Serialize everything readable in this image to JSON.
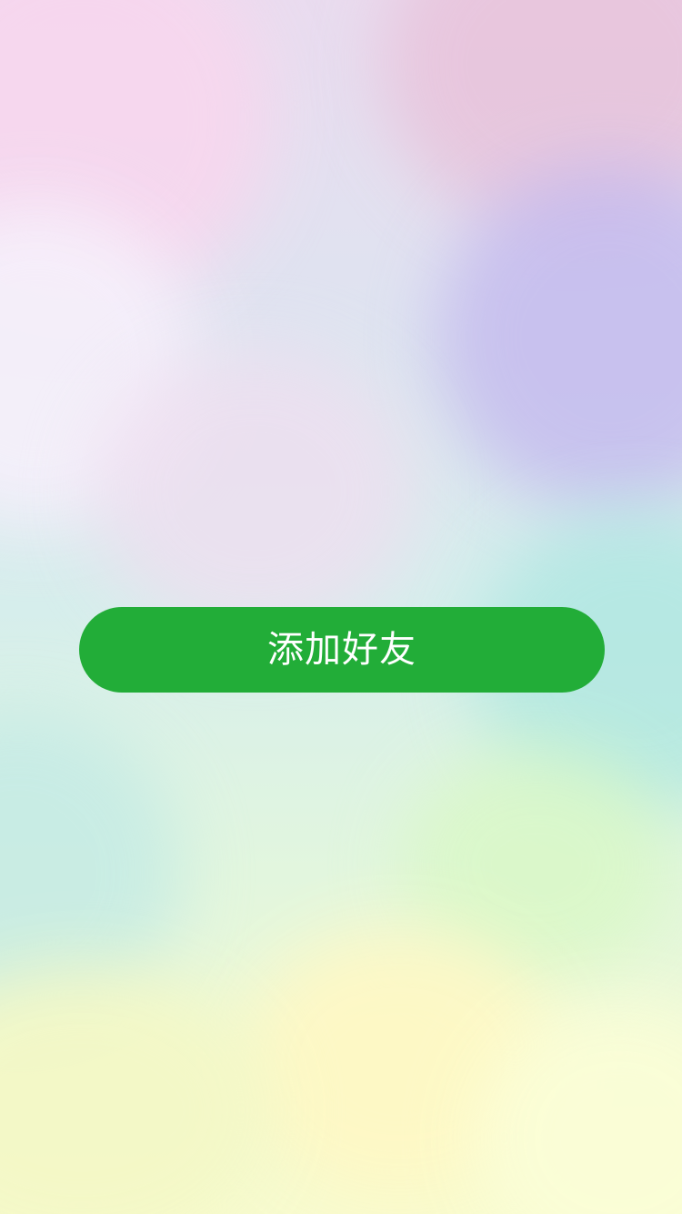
{
  "theme": {
    "accent": "#22ad38",
    "button_text_color": "#ffffff"
  },
  "main": {
    "add_friend_label": "添加好友"
  }
}
